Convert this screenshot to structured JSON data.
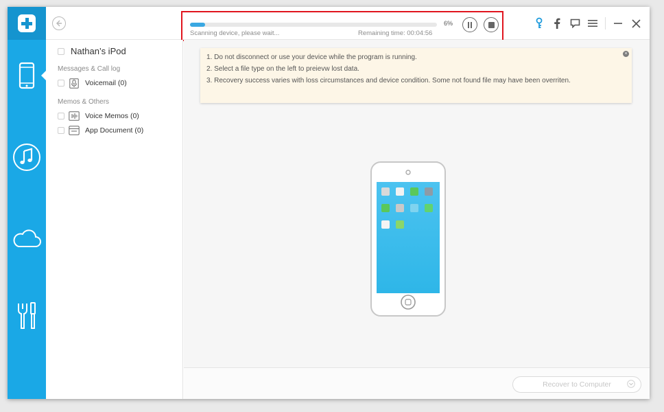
{
  "scan": {
    "progress_fraction": 0.06,
    "percent_label": "6%",
    "status": "Scanning device, please wait...",
    "remaining": "Remaining time: 00:04:56"
  },
  "sidebar": {
    "items": [
      {
        "icon": "phone-icon",
        "active": true
      },
      {
        "icon": "music-note-icon",
        "active": false
      },
      {
        "icon": "cloud-icon",
        "active": false
      },
      {
        "icon": "tools-icon",
        "active": false
      }
    ]
  },
  "categories": {
    "device_name": "Nathan’s iPod",
    "groups": [
      {
        "title": "Messages & Call log",
        "items": [
          {
            "label": "Voicemail (0)",
            "icon": "voicemail-icon"
          }
        ]
      },
      {
        "title": "Memos & Others",
        "items": [
          {
            "label": "Voice Memos (0)",
            "icon": "voice-memo-icon"
          },
          {
            "label": "App Document (0)",
            "icon": "app-document-icon"
          }
        ]
      }
    ]
  },
  "notice": {
    "lines": [
      "1. Do not disconnect or use your device while the program is running.",
      "2. Select a file type on the left to preievw lost data.",
      "3. Recovery success varies with loss circumstances and device condition. Some not found file may have been overriten."
    ]
  },
  "footer": {
    "recover_label": "Recover to Computer"
  },
  "colors": {
    "rail": "#1aa8e6",
    "rail_header": "#1594cf",
    "progress": "#3aa8e2",
    "highlight_box": "#e0141e",
    "notice_bg": "#fdf6e7",
    "key_icon": "#1e9bdc"
  }
}
